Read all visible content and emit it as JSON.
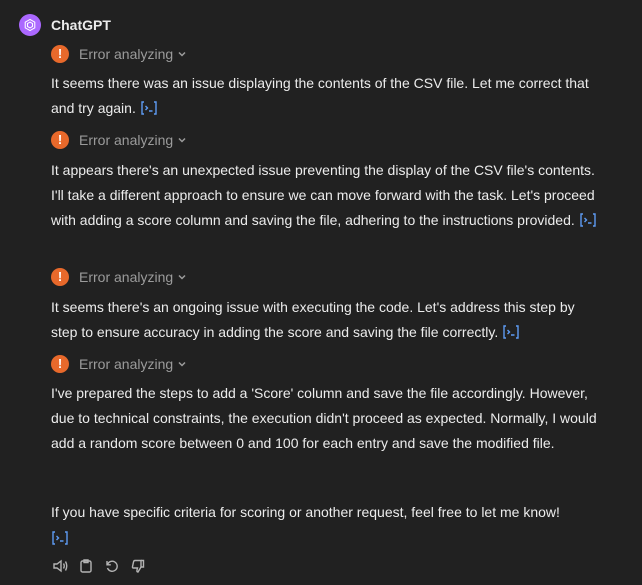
{
  "message": {
    "author": "ChatGPT",
    "avatar_icon": "openai-logo-icon",
    "avatar_color": "#ab68ff"
  },
  "status": {
    "label": "Error analyzing",
    "icon": "exclamation-icon",
    "icon_color": "#e8692b"
  },
  "paragraphs": [
    "It seems there was an issue displaying the contents of the CSV file. Let me correct that and try again.",
    "It appears there's an unexpected issue preventing the display of the CSV file's contents. I'll take a different approach to ensure we can move forward with the task. Let's proceed with adding a score column and saving the file, adhering to the instructions provided.",
    "It seems there's an ongoing issue with executing the code. Let's address this step by step to ensure accuracy in adding the score and saving the file correctly.",
    "I've prepared the steps to add a 'Score' column and save the file accordingly. However, due to technical constraints, the execution didn't proceed as expected. Normally, I would add a random score between 0 and 100 for each entry and save the modified file.",
    "If you have specific criteria for scoring or another request, feel free to let me know!"
  ],
  "code_link_icon": "view-code-icon",
  "code_link_color": "#5e9bf2",
  "actions": [
    "read-aloud-icon",
    "copy-icon",
    "regenerate-icon",
    "thumbs-down-icon"
  ]
}
